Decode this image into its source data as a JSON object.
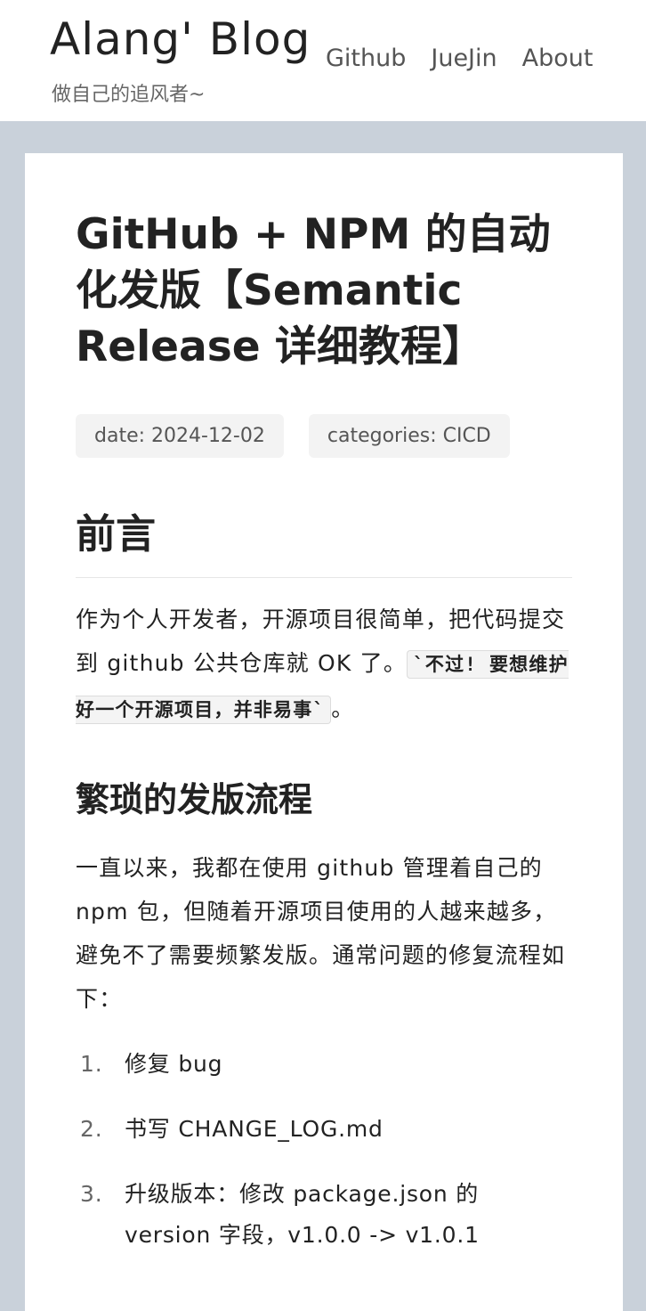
{
  "site": {
    "title": "Alang' Blog",
    "subtitle": "做自己的追风者~"
  },
  "nav": {
    "items": [
      {
        "label": "Github"
      },
      {
        "label": "JueJin"
      },
      {
        "label": "About"
      }
    ]
  },
  "post": {
    "title": "GitHub + NPM 的自动化发版【Semantic Release 详细教程】",
    "meta": {
      "date": "date: 2024-12-02",
      "categories": "categories: CICD"
    },
    "section1": {
      "heading": "前言",
      "text": "作为个人开发者，开源项目很简单，把代码提交到 github 公共仓库就 OK 了。",
      "code": "`不过! 要想维护好一个开源项目，并非易事`",
      "text_end": "。"
    },
    "section2": {
      "heading": "繁琐的发版流程",
      "text": "一直以来，我都在使用 github 管理着自己的 npm 包，但随着开源项目使用的人越来越多，避免不了需要频繁发版。通常问题的修复流程如下：",
      "steps": [
        {
          "num": "1.",
          "text": "修复 bug"
        },
        {
          "num": "2.",
          "text": "书写 CHANGE_LOG.md"
        },
        {
          "num": "3.",
          "text": "升级版本：修改 package.json 的 version 字段，v1.0.0 -> v1.0.1"
        }
      ]
    }
  },
  "colors": {
    "page_background": "#c9d1da",
    "card_background": "#ffffff",
    "text": "#222222",
    "muted": "#666666"
  }
}
